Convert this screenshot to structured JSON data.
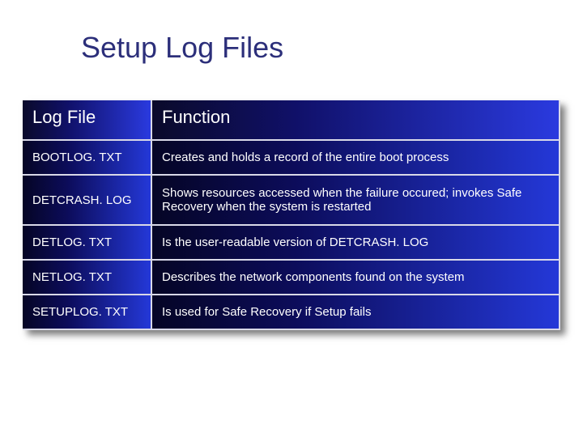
{
  "title": "Setup Log Files",
  "table": {
    "headers": {
      "file": "Log File",
      "func": "Function"
    },
    "rows": [
      {
        "file": "BOOTLOG. TXT",
        "func": "Creates and holds a record of the entire boot process"
      },
      {
        "file": "DETCRASH. LOG",
        "func": "Shows resources accessed when the failure occured; invokes Safe Recovery when the system is restarted"
      },
      {
        "file": "DETLOG. TXT",
        "func": "Is the user-readable version of DETCRASH. LOG"
      },
      {
        "file": "NETLOG. TXT",
        "func": "Describes the network components found on the system"
      },
      {
        "file": "SETUPLOG. TXT",
        "func": "Is used for Safe Recovery if Setup fails"
      }
    ]
  }
}
